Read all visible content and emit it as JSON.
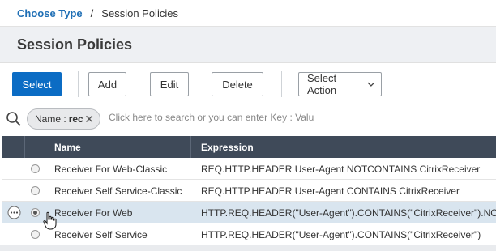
{
  "breadcrumb": {
    "link": "Choose Type",
    "separator": "/",
    "current": "Session Policies"
  },
  "page": {
    "title": "Session Policies"
  },
  "toolbar": {
    "select_label": "Select",
    "add_label": "Add",
    "edit_label": "Edit",
    "delete_label": "Delete",
    "select_action_label": "Select Action"
  },
  "search": {
    "chip_key": "Name :",
    "chip_value": "rec",
    "placeholder": "Click here to search or you can enter Key : Valu"
  },
  "table": {
    "headers": {
      "name": "Name",
      "expression": "Expression"
    },
    "rows": [
      {
        "name": "Receiver For Web-Classic",
        "expression": "REQ.HTTP.HEADER User-Agent NOTCONTAINS CitrixReceiver",
        "selected": false
      },
      {
        "name": "Receiver Self Service-Classic",
        "expression": "REQ.HTTP.HEADER User-Agent CONTAINS CitrixReceiver",
        "selected": false
      },
      {
        "name": "Receiver For Web",
        "expression": "HTTP.REQ.HEADER(\"User-Agent\").CONTAINS(\"CitrixReceiver\").NOT",
        "selected": true
      },
      {
        "name": "Receiver Self Service",
        "expression": "HTTP.REQ.HEADER(\"User-Agent\").CONTAINS(\"CitrixReceiver\")",
        "selected": false
      }
    ]
  },
  "colors": {
    "primary": "#0b6cc4",
    "link": "#1f6fb5",
    "header_bg": "#3f4a59",
    "selected_row": "#d9e5ef"
  }
}
